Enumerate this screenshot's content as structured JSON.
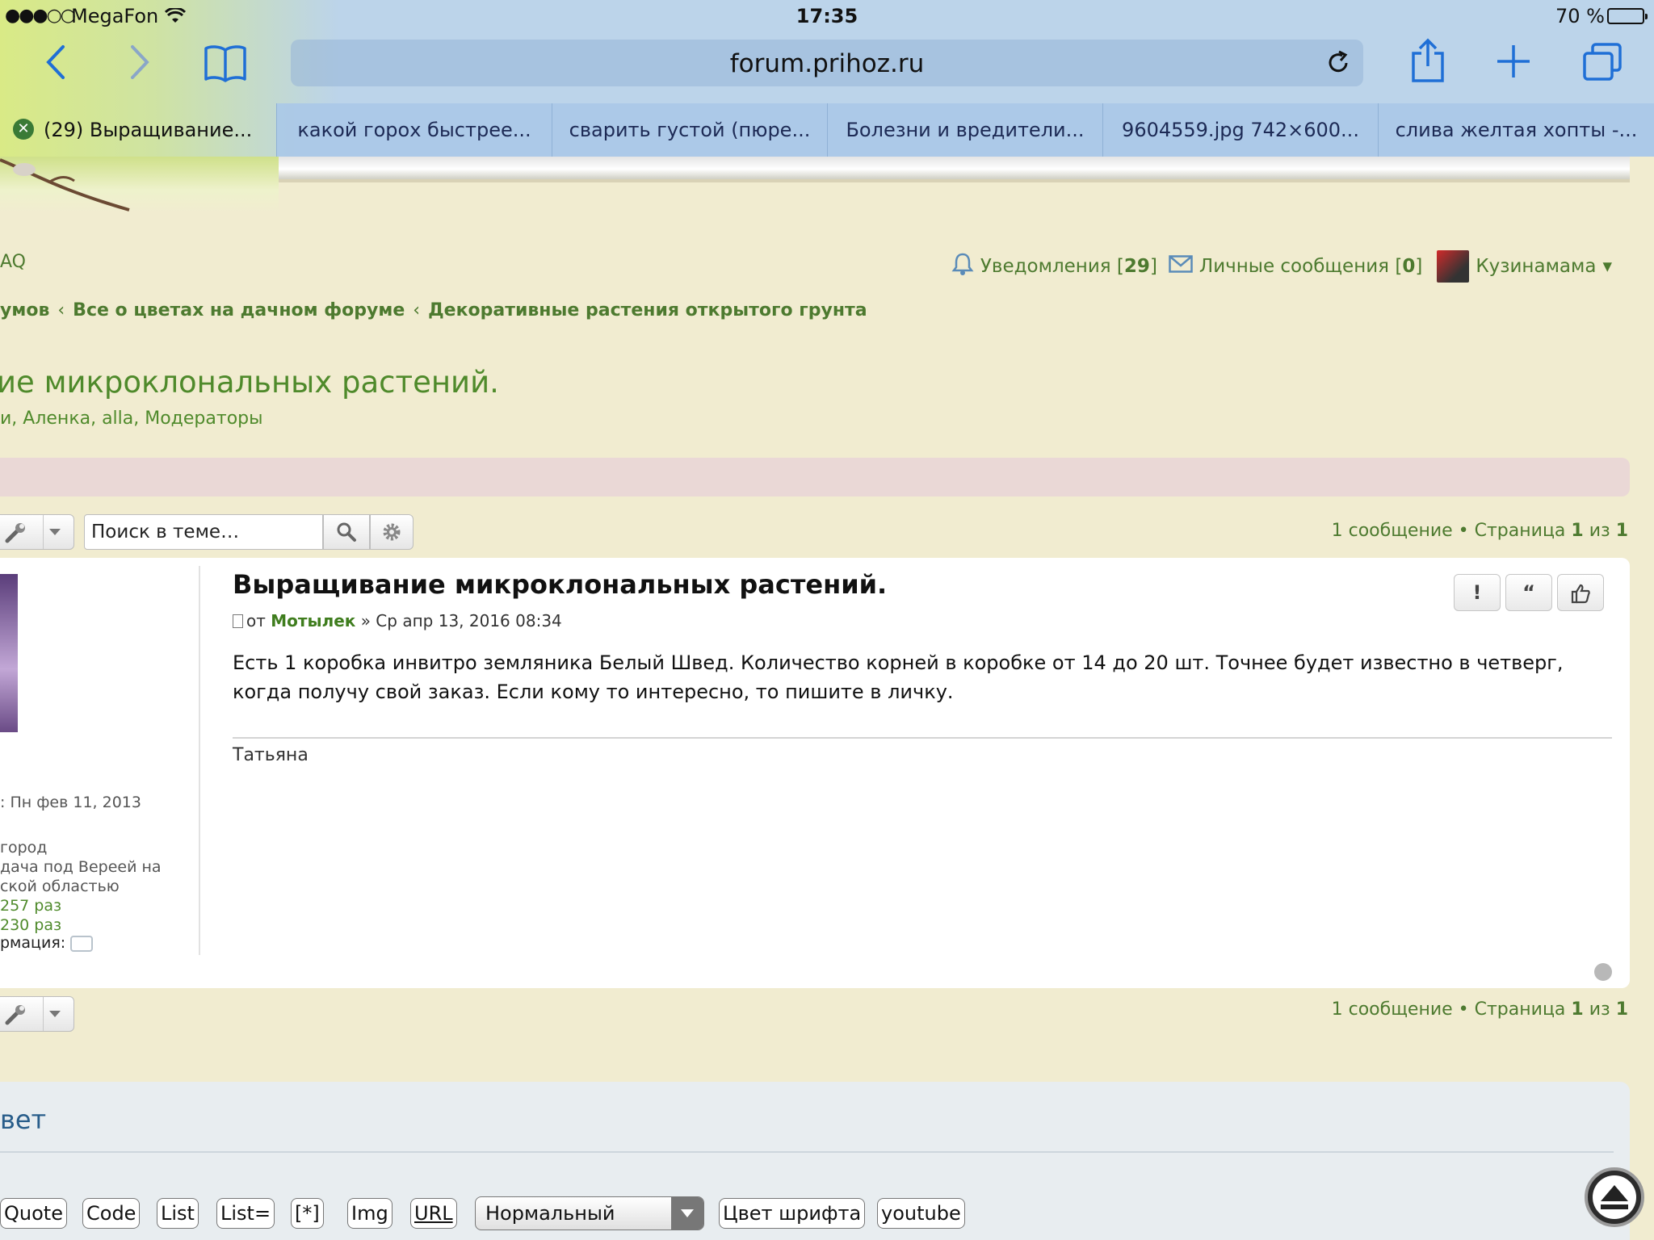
{
  "status_bar": {
    "signal": "●●●○○",
    "carrier": "MegaFon",
    "time": "17:35",
    "battery_percent": "70 %",
    "battery_level": 0.7
  },
  "browser": {
    "url": "forum.prihoz.ru",
    "tabs": [
      {
        "label": "(29) Выращивание...",
        "active": true
      },
      {
        "label": "какой горох быстрее...",
        "active": false
      },
      {
        "label": "сварить густой (пюре...",
        "active": false
      },
      {
        "label": "Болезни и вредители...",
        "active": false
      },
      {
        "label": "9604559.jpg 742×600...",
        "active": false
      },
      {
        "label": "слива желтая хопты -...",
        "active": false
      }
    ]
  },
  "header": {
    "faq": "AQ",
    "notifications_label": "Уведомления [",
    "notifications_count": "29",
    "notifications_close": "]",
    "messages_label": "Личные сообщения [",
    "messages_count": "0",
    "messages_close": "]",
    "username": "Кузинамама",
    "user_menu_arrow": "▾"
  },
  "breadcrumb": {
    "items": [
      "умов",
      "Все о цветах на дачном форуме",
      "Декоративные растения открытого грунта"
    ],
    "separator": "‹"
  },
  "topic": {
    "title": "ие микроклональных растений.",
    "moderators": "и, Аленка, alla, Модераторы"
  },
  "toolbar": {
    "search_placeholder": "Поиск в теме…",
    "pagination_count": "1 сообщение • Страница ",
    "pagination_page": "1",
    "pagination_of": " из ",
    "pagination_total": "1"
  },
  "post": {
    "title": "Выращивание микроклональных растений.",
    "by": "от ",
    "author": "Мотылек",
    "date": " » Ср апр 13, 2016 08:34",
    "body": "Есть 1 коробка инвитро земляника Белый Швед. Количество корней в коробке от 14 до 20 шт. Точнее будет известно в четверг, когда получу свой заказ. Если кому то интересно, то пишите в личку.",
    "signature": "Татьяна",
    "report_label": "!",
    "quote_label": "“"
  },
  "profile": {
    "registered": ": Пн фев 11, 2013",
    "location_1": "город",
    "location_2": "дача под Вереей на",
    "location_3": "ской областью",
    "thanks_given": "257 раз",
    "thanks_received": "230 раз",
    "contact": "рмация:"
  },
  "reply": {
    "title": "вет",
    "buttons": [
      "Quote",
      "Code",
      "List",
      "List=",
      "[*]",
      "Img",
      "URL"
    ],
    "font_size_value": "Нормальный",
    "color_button": "Цвет шрифта",
    "youtube_button": "youtube"
  }
}
